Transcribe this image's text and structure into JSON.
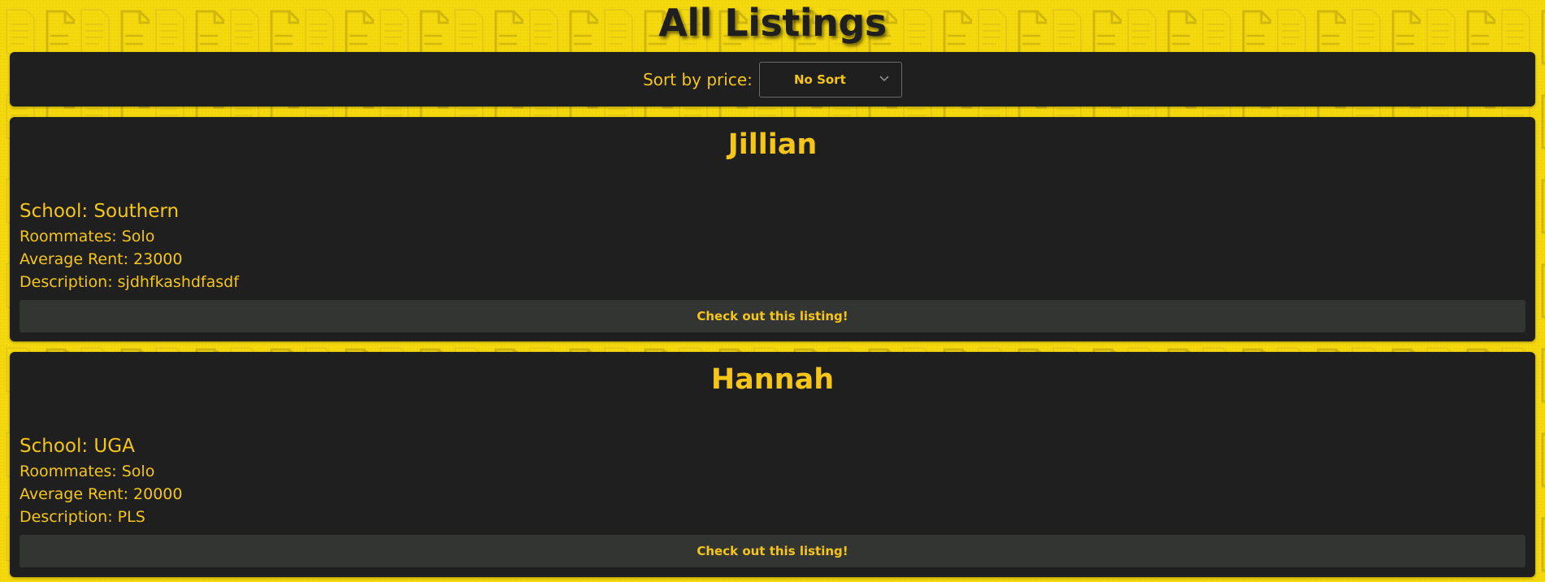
{
  "page_title": "All Listings",
  "sort": {
    "label": "Sort by price:",
    "selected": "No Sort"
  },
  "listings": [
    {
      "name": "Jillian",
      "school": "School: Southern",
      "roommates": "Roommates: Solo",
      "rent": "Average Rent: 23000",
      "description": "Description: sjdhfkashdfasdf",
      "button_label": "Check out this listing!"
    },
    {
      "name": "Hannah",
      "school": "School: UGA",
      "roommates": "Roommates: Solo",
      "rent": "Average Rent: 20000",
      "description": "Description: PLS",
      "button_label": "Check out this listing!"
    }
  ],
  "colors": {
    "background": "#f5d90f",
    "panel": "#1f1f1f",
    "accent_text": "#f5c518",
    "button": "#333533"
  },
  "background_icon": "document-icon"
}
